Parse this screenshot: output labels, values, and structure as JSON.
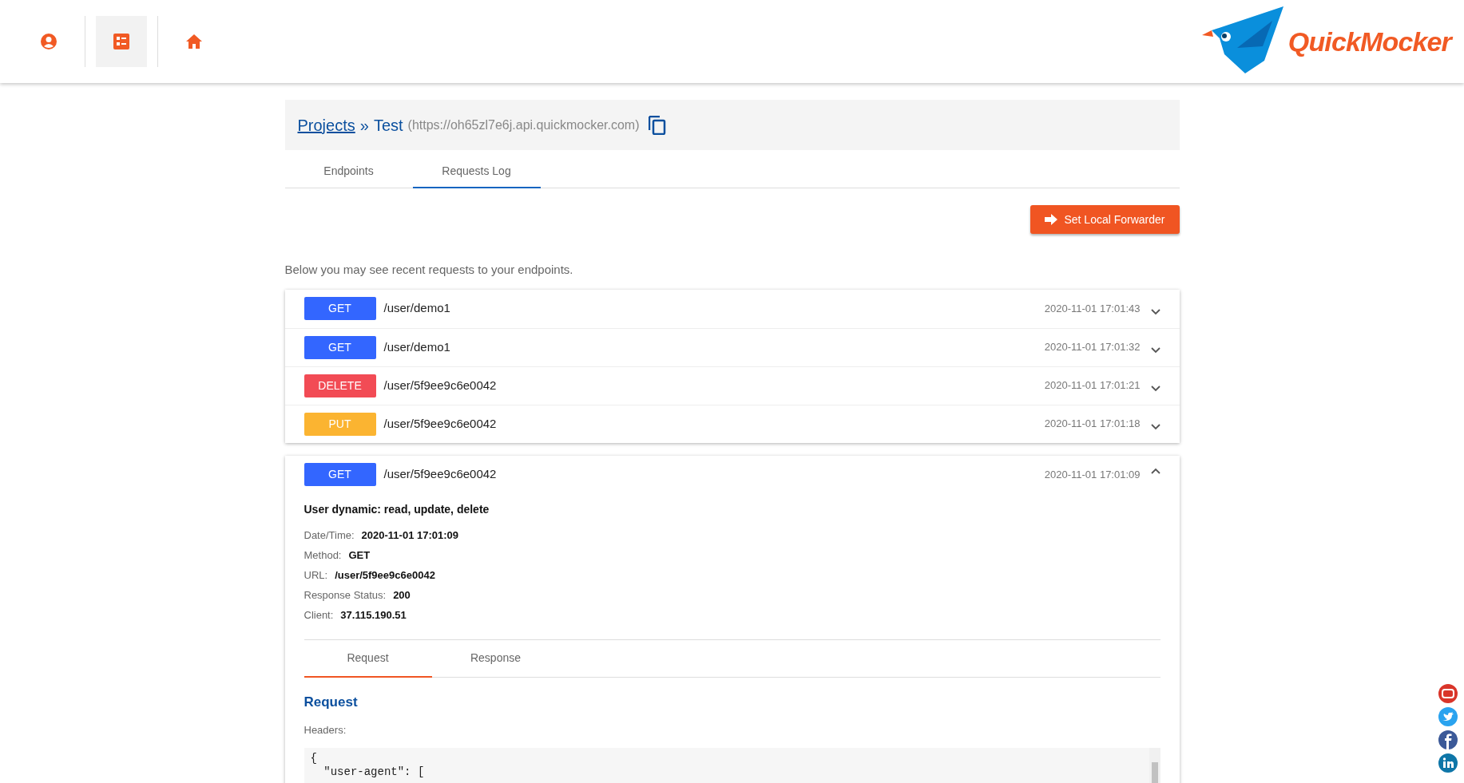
{
  "nav": {
    "items": [
      {
        "kind": "user",
        "selected": false
      },
      {
        "kind": "list",
        "selected": true
      },
      {
        "kind": "home",
        "selected": false
      }
    ],
    "logo": "QuickMocker"
  },
  "breadcrumb": {
    "link": "Projects",
    "separator": "»",
    "project": "Test",
    "url": "(https://oh65zl7e6j.api.quickmocker.com)"
  },
  "tabs": [
    {
      "label": "Endpoints",
      "selected": false
    },
    {
      "label": "Requests Log",
      "selected": true
    }
  ],
  "forwarder_button": "Set Local Forwarder",
  "intro": "Below you may see recent requests to your endpoints.",
  "requests": [
    {
      "method": "GET",
      "color": "#3366ff",
      "path": "/user/demo1",
      "time": "2020-11-01 17:01:43",
      "expanded": false
    },
    {
      "method": "GET",
      "color": "#3366ff",
      "path": "/user/demo1",
      "time": "2020-11-01 17:01:32",
      "expanded": false
    },
    {
      "method": "DELETE",
      "color": "#f24b55",
      "path": "/user/5f9ee9c6e0042",
      "time": "2020-11-01 17:01:21",
      "expanded": false
    },
    {
      "method": "PUT",
      "color": "#fbb431",
      "path": "/user/5f9ee9c6e0042",
      "time": "2020-11-01 17:01:18",
      "expanded": false
    },
    {
      "method": "GET",
      "color": "#3366ff",
      "path": "/user/5f9ee9c6e0042",
      "time": "2020-11-01 17:01:09",
      "expanded": true,
      "details": {
        "title": "User dynamic: read, update, delete",
        "fields": [
          {
            "label": "Date/Time:",
            "value": "2020-11-01 17:01:09"
          },
          {
            "label": "Method:",
            "value": "GET"
          },
          {
            "label": "URL:",
            "value": "/user/5f9ee9c6e0042"
          },
          {
            "label": "Response Status:",
            "value": "200"
          },
          {
            "label": "Client:",
            "value": "37.115.190.51"
          }
        ],
        "tabs": [
          {
            "label": "Request",
            "selected": true
          },
          {
            "label": "Response",
            "selected": false
          }
        ],
        "section_title": "Request",
        "headers_label": "Headers:",
        "code_lines": [
          "{",
          "  \"user-agent\": ["
        ]
      }
    }
  ],
  "social": [
    {
      "kind": "youtube"
    },
    {
      "kind": "twitter"
    },
    {
      "kind": "facebook"
    },
    {
      "kind": "linkedin"
    }
  ]
}
